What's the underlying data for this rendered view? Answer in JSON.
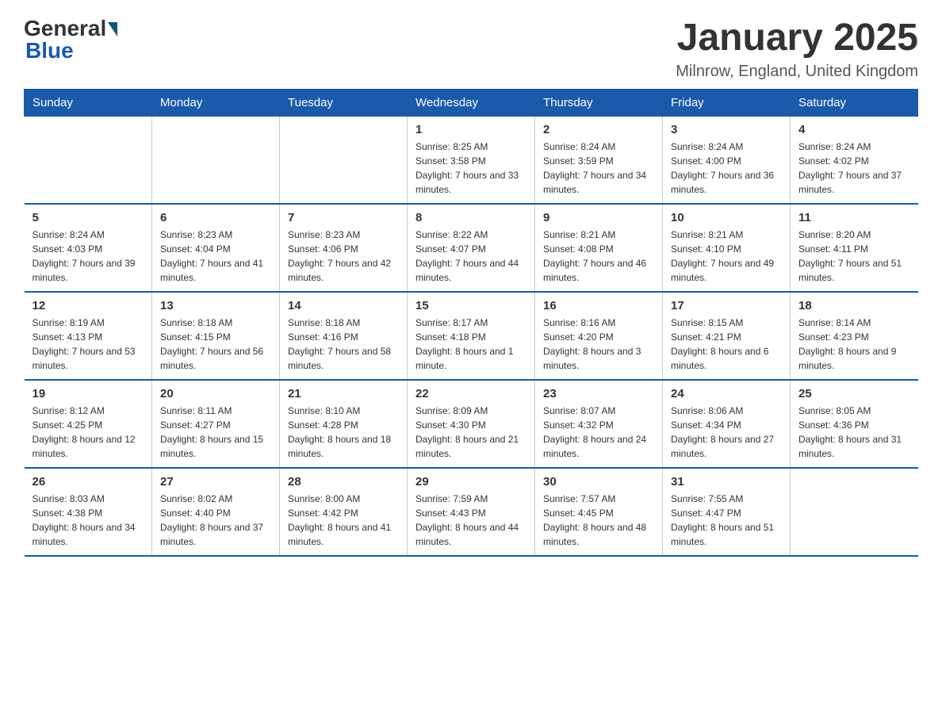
{
  "header": {
    "logo_general": "General",
    "logo_blue": "Blue",
    "title": "January 2025",
    "subtitle": "Milnrow, England, United Kingdom"
  },
  "days_of_week": [
    "Sunday",
    "Monday",
    "Tuesday",
    "Wednesday",
    "Thursday",
    "Friday",
    "Saturday"
  ],
  "weeks": [
    [
      {
        "day": "",
        "info": ""
      },
      {
        "day": "",
        "info": ""
      },
      {
        "day": "",
        "info": ""
      },
      {
        "day": "1",
        "info": "Sunrise: 8:25 AM\nSunset: 3:58 PM\nDaylight: 7 hours and 33 minutes."
      },
      {
        "day": "2",
        "info": "Sunrise: 8:24 AM\nSunset: 3:59 PM\nDaylight: 7 hours and 34 minutes."
      },
      {
        "day": "3",
        "info": "Sunrise: 8:24 AM\nSunset: 4:00 PM\nDaylight: 7 hours and 36 minutes."
      },
      {
        "day": "4",
        "info": "Sunrise: 8:24 AM\nSunset: 4:02 PM\nDaylight: 7 hours and 37 minutes."
      }
    ],
    [
      {
        "day": "5",
        "info": "Sunrise: 8:24 AM\nSunset: 4:03 PM\nDaylight: 7 hours and 39 minutes."
      },
      {
        "day": "6",
        "info": "Sunrise: 8:23 AM\nSunset: 4:04 PM\nDaylight: 7 hours and 41 minutes."
      },
      {
        "day": "7",
        "info": "Sunrise: 8:23 AM\nSunset: 4:06 PM\nDaylight: 7 hours and 42 minutes."
      },
      {
        "day": "8",
        "info": "Sunrise: 8:22 AM\nSunset: 4:07 PM\nDaylight: 7 hours and 44 minutes."
      },
      {
        "day": "9",
        "info": "Sunrise: 8:21 AM\nSunset: 4:08 PM\nDaylight: 7 hours and 46 minutes."
      },
      {
        "day": "10",
        "info": "Sunrise: 8:21 AM\nSunset: 4:10 PM\nDaylight: 7 hours and 49 minutes."
      },
      {
        "day": "11",
        "info": "Sunrise: 8:20 AM\nSunset: 4:11 PM\nDaylight: 7 hours and 51 minutes."
      }
    ],
    [
      {
        "day": "12",
        "info": "Sunrise: 8:19 AM\nSunset: 4:13 PM\nDaylight: 7 hours and 53 minutes."
      },
      {
        "day": "13",
        "info": "Sunrise: 8:18 AM\nSunset: 4:15 PM\nDaylight: 7 hours and 56 minutes."
      },
      {
        "day": "14",
        "info": "Sunrise: 8:18 AM\nSunset: 4:16 PM\nDaylight: 7 hours and 58 minutes."
      },
      {
        "day": "15",
        "info": "Sunrise: 8:17 AM\nSunset: 4:18 PM\nDaylight: 8 hours and 1 minute."
      },
      {
        "day": "16",
        "info": "Sunrise: 8:16 AM\nSunset: 4:20 PM\nDaylight: 8 hours and 3 minutes."
      },
      {
        "day": "17",
        "info": "Sunrise: 8:15 AM\nSunset: 4:21 PM\nDaylight: 8 hours and 6 minutes."
      },
      {
        "day": "18",
        "info": "Sunrise: 8:14 AM\nSunset: 4:23 PM\nDaylight: 8 hours and 9 minutes."
      }
    ],
    [
      {
        "day": "19",
        "info": "Sunrise: 8:12 AM\nSunset: 4:25 PM\nDaylight: 8 hours and 12 minutes."
      },
      {
        "day": "20",
        "info": "Sunrise: 8:11 AM\nSunset: 4:27 PM\nDaylight: 8 hours and 15 minutes."
      },
      {
        "day": "21",
        "info": "Sunrise: 8:10 AM\nSunset: 4:28 PM\nDaylight: 8 hours and 18 minutes."
      },
      {
        "day": "22",
        "info": "Sunrise: 8:09 AM\nSunset: 4:30 PM\nDaylight: 8 hours and 21 minutes."
      },
      {
        "day": "23",
        "info": "Sunrise: 8:07 AM\nSunset: 4:32 PM\nDaylight: 8 hours and 24 minutes."
      },
      {
        "day": "24",
        "info": "Sunrise: 8:06 AM\nSunset: 4:34 PM\nDaylight: 8 hours and 27 minutes."
      },
      {
        "day": "25",
        "info": "Sunrise: 8:05 AM\nSunset: 4:36 PM\nDaylight: 8 hours and 31 minutes."
      }
    ],
    [
      {
        "day": "26",
        "info": "Sunrise: 8:03 AM\nSunset: 4:38 PM\nDaylight: 8 hours and 34 minutes."
      },
      {
        "day": "27",
        "info": "Sunrise: 8:02 AM\nSunset: 4:40 PM\nDaylight: 8 hours and 37 minutes."
      },
      {
        "day": "28",
        "info": "Sunrise: 8:00 AM\nSunset: 4:42 PM\nDaylight: 8 hours and 41 minutes."
      },
      {
        "day": "29",
        "info": "Sunrise: 7:59 AM\nSunset: 4:43 PM\nDaylight: 8 hours and 44 minutes."
      },
      {
        "day": "30",
        "info": "Sunrise: 7:57 AM\nSunset: 4:45 PM\nDaylight: 8 hours and 48 minutes."
      },
      {
        "day": "31",
        "info": "Sunrise: 7:55 AM\nSunset: 4:47 PM\nDaylight: 8 hours and 51 minutes."
      },
      {
        "day": "",
        "info": ""
      }
    ]
  ],
  "colors": {
    "header_bg": "#1a5aab",
    "header_text": "#ffffff",
    "border": "#1a5aab"
  }
}
